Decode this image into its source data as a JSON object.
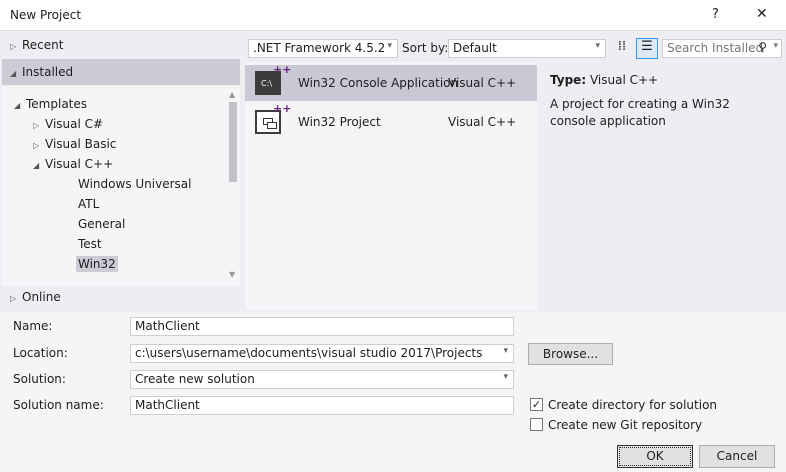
{
  "window": {
    "title": "New Project",
    "help": "?",
    "close": "✕"
  },
  "sidebar": {
    "recent": "Recent",
    "installed": "Installed",
    "online": "Online",
    "tree": [
      {
        "label": "Templates",
        "level": 0,
        "state": "expanded"
      },
      {
        "label": "Visual C#",
        "level": 1,
        "state": "collapsed"
      },
      {
        "label": "Visual Basic",
        "level": 1,
        "state": "collapsed"
      },
      {
        "label": "Visual C++",
        "level": 1,
        "state": "expanded"
      },
      {
        "label": "Windows Universal",
        "level": 2
      },
      {
        "label": "ATL",
        "level": 2
      },
      {
        "label": "General",
        "level": 2
      },
      {
        "label": "Test",
        "level": 2
      },
      {
        "label": "Win32",
        "level": 2,
        "selected": true
      }
    ]
  },
  "toolbar": {
    "framework": ".NET Framework 4.5.2",
    "sort_label": "Sort by:",
    "sort_value": "Default",
    "search_placeholder": "Search Installed"
  },
  "templates": [
    {
      "name": "Win32 Console Application",
      "lang": "Visual C++",
      "selected": true,
      "icon": "console-app-icon"
    },
    {
      "name": "Win32 Project",
      "lang": "Visual C++",
      "icon": "win32-project-icon"
    }
  ],
  "details": {
    "type_label": "Type:",
    "type_value": "Visual C++",
    "description": "A project for creating a Win32 console application"
  },
  "form": {
    "name_label": "Name:",
    "name_value": "MathClient",
    "location_label": "Location:",
    "location_value": "c:\\users\\username\\documents\\visual studio 2017\\Projects",
    "browse": "Browse...",
    "solution_label": "Solution:",
    "solution_value": "Create new solution",
    "solution_name_label": "Solution name:",
    "solution_name_value": "MathClient",
    "create_dir": "Create directory for solution",
    "create_dir_checked": true,
    "create_git": "Create new Git repository",
    "create_git_checked": false,
    "ok": "OK",
    "cancel": "Cancel"
  },
  "colors": {
    "selection": "#c9c9d6",
    "accent_plus": "#68217a"
  }
}
